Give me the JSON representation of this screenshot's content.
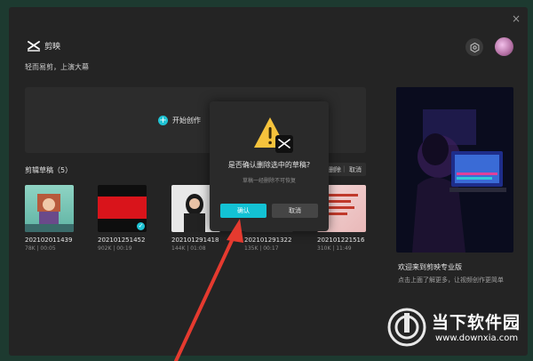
{
  "window": {
    "close_glyph": "×"
  },
  "header": {
    "app_name": "剪映",
    "slogan": "轻而易剪，上演大幕",
    "icons": {
      "logo": "jianying-logo-icon",
      "settings": "settings-icon",
      "avatar": "avatar"
    }
  },
  "create": {
    "label": "开始创作",
    "icon_glyph": "+"
  },
  "drafts": {
    "title": "剪辑草稿（5）",
    "actions": {
      "delete": "删除",
      "separator": "|",
      "cancel": "取消"
    },
    "items": [
      {
        "name": "202102011439",
        "meta": "78K | 00:05",
        "selected": false
      },
      {
        "name": "202101251452",
        "meta": "902K | 00:19",
        "selected": true
      },
      {
        "name": "202101291418",
        "meta": "144K | 01:08",
        "selected": false
      },
      {
        "name": "202101291322",
        "meta": "135K | 00:17",
        "selected": false
      },
      {
        "name": "202101221516",
        "meta": "310K | 11:49",
        "selected": false
      }
    ]
  },
  "promo": {
    "title": "欢迎来到剪映专业版",
    "desc": "点击上面了解更多，让视频创作更简单"
  },
  "dialog": {
    "title": "是否确认删除选中的草稿?",
    "subtitle": "草稿一经删除不可恢复",
    "confirm": "确认",
    "cancel": "取消",
    "icon": "warning-icon"
  },
  "watermark": {
    "name": "当下软件园",
    "url": "www.downxia.com"
  },
  "colors": {
    "accent": "#13c2d4",
    "background": "#242424",
    "arrow": "#e53a2f"
  }
}
